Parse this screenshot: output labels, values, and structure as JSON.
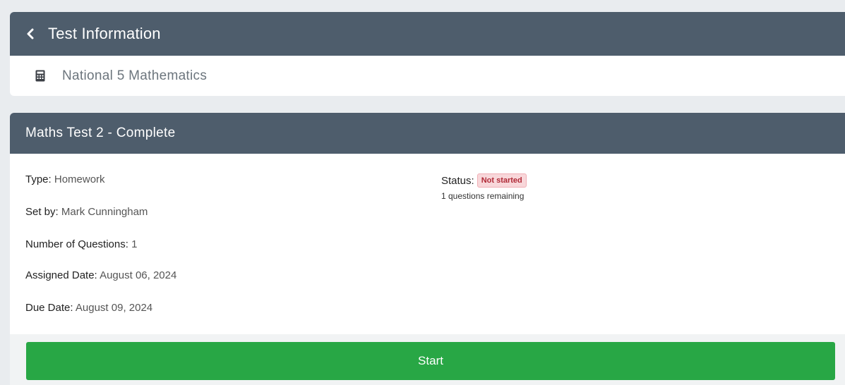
{
  "header": {
    "title": "Test Information",
    "back_icon": "chevron-left-icon"
  },
  "subject": {
    "icon": "calculator-icon",
    "name": "National 5 Mathematics"
  },
  "test": {
    "title": "Maths Test 2 - Complete",
    "details": [
      {
        "label": "Type:",
        "value": "Homework"
      },
      {
        "label": "Set by:",
        "value": "Mark Cunningham"
      },
      {
        "label": "Number of Questions:",
        "value": "1"
      },
      {
        "label": "Assigned Date:",
        "value": "August 06, 2024"
      },
      {
        "label": "Due Date:",
        "value": "August 09, 2024"
      }
    ],
    "status_label": "Status:",
    "status_badge": "Not started",
    "remaining": "1 questions remaining",
    "start_label": "Start"
  },
  "colors": {
    "header_bg": "#4e5d6c",
    "start_button": "#28a745",
    "badge_bg": "#f8d7da",
    "badge_text": "#b02a37"
  }
}
